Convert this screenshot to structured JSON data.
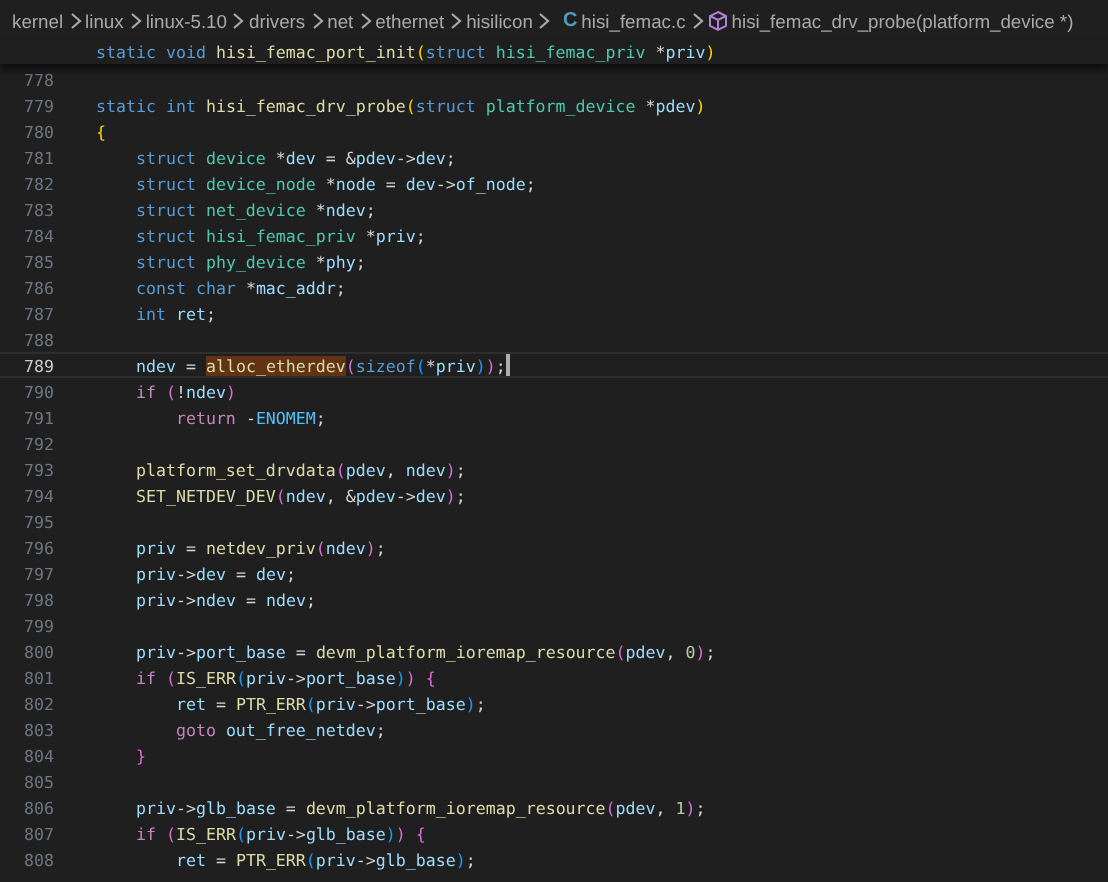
{
  "breadcrumbs": [
    {
      "label": "kernel"
    },
    {
      "label": "linux"
    },
    {
      "label": "linux-5.10"
    },
    {
      "label": "drivers"
    },
    {
      "label": "net"
    },
    {
      "label": "ethernet"
    },
    {
      "label": "hisilicon"
    },
    {
      "label": "hisi_femac.c",
      "kind": "file",
      "icon_text": "C"
    },
    {
      "label": "hisi_femac_drv_probe(platform_device *)",
      "kind": "symbol"
    }
  ],
  "sticky_line": {
    "tokens": [
      {
        "kind": "kw",
        "text": "static void "
      },
      {
        "kind": "fn",
        "text": "hisi_femac_port_init"
      },
      {
        "kind": "b1",
        "text": "("
      },
      {
        "kind": "kw",
        "text": "struct "
      },
      {
        "kind": "type",
        "text": "hisi_femac_priv "
      },
      {
        "kind": "p",
        "text": "*"
      },
      {
        "kind": "var",
        "text": "priv"
      },
      {
        "kind": "b1",
        "text": ")"
      }
    ]
  },
  "lines": [
    {
      "number": "778"
    },
    {
      "number": "779",
      "tokens": [
        {
          "kind": "kw",
          "text": "static int "
        },
        {
          "kind": "fn",
          "text": "hisi_femac_drv_probe"
        },
        {
          "kind": "b1",
          "text": "("
        },
        {
          "kind": "kw",
          "text": "struct "
        },
        {
          "kind": "type",
          "text": "platform_device "
        },
        {
          "kind": "p",
          "text": "*"
        },
        {
          "kind": "var",
          "text": "pdev"
        },
        {
          "kind": "b1",
          "text": ")"
        }
      ]
    },
    {
      "number": "780",
      "tokens": [
        {
          "kind": "b1",
          "text": "{"
        }
      ]
    },
    {
      "number": "781",
      "tokens": [
        {
          "kind": "kw",
          "text": "    struct "
        },
        {
          "kind": "type",
          "text": "device "
        },
        {
          "kind": "p",
          "text": "*"
        },
        {
          "kind": "var",
          "text": "dev"
        },
        {
          "kind": "p",
          "text": " = &"
        },
        {
          "kind": "var",
          "text": "pdev"
        },
        {
          "kind": "p",
          "text": "->"
        },
        {
          "kind": "var",
          "text": "dev"
        },
        {
          "kind": "p",
          "text": ";"
        }
      ]
    },
    {
      "number": "782",
      "tokens": [
        {
          "kind": "kw",
          "text": "    struct "
        },
        {
          "kind": "type",
          "text": "device_node "
        },
        {
          "kind": "p",
          "text": "*"
        },
        {
          "kind": "var",
          "text": "node"
        },
        {
          "kind": "p",
          "text": " = "
        },
        {
          "kind": "var",
          "text": "dev"
        },
        {
          "kind": "p",
          "text": "->"
        },
        {
          "kind": "var",
          "text": "of_node"
        },
        {
          "kind": "p",
          "text": ";"
        }
      ]
    },
    {
      "number": "783",
      "tokens": [
        {
          "kind": "kw",
          "text": "    struct "
        },
        {
          "kind": "type",
          "text": "net_device "
        },
        {
          "kind": "p",
          "text": "*"
        },
        {
          "kind": "var",
          "text": "ndev"
        },
        {
          "kind": "p",
          "text": ";"
        }
      ]
    },
    {
      "number": "784",
      "tokens": [
        {
          "kind": "kw",
          "text": "    struct "
        },
        {
          "kind": "type",
          "text": "hisi_femac_priv "
        },
        {
          "kind": "p",
          "text": "*"
        },
        {
          "kind": "var",
          "text": "priv"
        },
        {
          "kind": "p",
          "text": ";"
        }
      ]
    },
    {
      "number": "785",
      "tokens": [
        {
          "kind": "kw",
          "text": "    struct "
        },
        {
          "kind": "type",
          "text": "phy_device "
        },
        {
          "kind": "p",
          "text": "*"
        },
        {
          "kind": "var",
          "text": "phy"
        },
        {
          "kind": "p",
          "text": ";"
        }
      ]
    },
    {
      "number": "786",
      "tokens": [
        {
          "kind": "kw",
          "text": "    const char "
        },
        {
          "kind": "p",
          "text": "*"
        },
        {
          "kind": "var",
          "text": "mac_addr"
        },
        {
          "kind": "p",
          "text": ";"
        }
      ]
    },
    {
      "number": "787",
      "tokens": [
        {
          "kind": "kw",
          "text": "    int "
        },
        {
          "kind": "var",
          "text": "ret"
        },
        {
          "kind": "p",
          "text": ";"
        }
      ]
    },
    {
      "number": "788"
    },
    {
      "number": "789",
      "current": true,
      "cursor": true,
      "tokens": [
        {
          "kind": "var",
          "text": "    ndev"
        },
        {
          "kind": "p",
          "text": " = "
        },
        {
          "kind": "fn",
          "text": "alloc_etherdev",
          "highlight": true
        },
        {
          "kind": "b2",
          "text": "("
        },
        {
          "kind": "kw",
          "text": "sizeof"
        },
        {
          "kind": "b3",
          "text": "("
        },
        {
          "kind": "p",
          "text": "*"
        },
        {
          "kind": "var",
          "text": "priv"
        },
        {
          "kind": "b3",
          "text": ")"
        },
        {
          "kind": "b2",
          "text": ")"
        },
        {
          "kind": "p",
          "text": ";"
        }
      ]
    },
    {
      "number": "790",
      "tokens": [
        {
          "kind": "ctl",
          "text": "    if "
        },
        {
          "kind": "b2",
          "text": "("
        },
        {
          "kind": "p",
          "text": "!"
        },
        {
          "kind": "var",
          "text": "ndev"
        },
        {
          "kind": "b2",
          "text": ")"
        }
      ]
    },
    {
      "number": "791",
      "tokens": [
        {
          "kind": "ctl",
          "text": "        return "
        },
        {
          "kind": "p",
          "text": "-"
        },
        {
          "kind": "const",
          "text": "ENOMEM"
        },
        {
          "kind": "p",
          "text": ";"
        }
      ]
    },
    {
      "number": "792"
    },
    {
      "number": "793",
      "tokens": [
        {
          "kind": "fn",
          "text": "    platform_set_drvdata"
        },
        {
          "kind": "b2",
          "text": "("
        },
        {
          "kind": "var",
          "text": "pdev"
        },
        {
          "kind": "p",
          "text": ", "
        },
        {
          "kind": "var",
          "text": "ndev"
        },
        {
          "kind": "b2",
          "text": ")"
        },
        {
          "kind": "p",
          "text": ";"
        }
      ]
    },
    {
      "number": "794",
      "tokens": [
        {
          "kind": "fn",
          "text": "    SET_NETDEV_DEV"
        },
        {
          "kind": "b2",
          "text": "("
        },
        {
          "kind": "var",
          "text": "ndev"
        },
        {
          "kind": "p",
          "text": ", &"
        },
        {
          "kind": "var",
          "text": "pdev"
        },
        {
          "kind": "p",
          "text": "->"
        },
        {
          "kind": "var",
          "text": "dev"
        },
        {
          "kind": "b2",
          "text": ")"
        },
        {
          "kind": "p",
          "text": ";"
        }
      ]
    },
    {
      "number": "795"
    },
    {
      "number": "796",
      "tokens": [
        {
          "kind": "var",
          "text": "    priv"
        },
        {
          "kind": "p",
          "text": " = "
        },
        {
          "kind": "fn",
          "text": "netdev_priv"
        },
        {
          "kind": "b2",
          "text": "("
        },
        {
          "kind": "var",
          "text": "ndev"
        },
        {
          "kind": "b2",
          "text": ")"
        },
        {
          "kind": "p",
          "text": ";"
        }
      ]
    },
    {
      "number": "797",
      "tokens": [
        {
          "kind": "var",
          "text": "    priv"
        },
        {
          "kind": "p",
          "text": "->"
        },
        {
          "kind": "var",
          "text": "dev"
        },
        {
          "kind": "p",
          "text": " = "
        },
        {
          "kind": "var",
          "text": "dev"
        },
        {
          "kind": "p",
          "text": ";"
        }
      ]
    },
    {
      "number": "798",
      "tokens": [
        {
          "kind": "var",
          "text": "    priv"
        },
        {
          "kind": "p",
          "text": "->"
        },
        {
          "kind": "var",
          "text": "ndev"
        },
        {
          "kind": "p",
          "text": " = "
        },
        {
          "kind": "var",
          "text": "ndev"
        },
        {
          "kind": "p",
          "text": ";"
        }
      ]
    },
    {
      "number": "799"
    },
    {
      "number": "800",
      "tokens": [
        {
          "kind": "var",
          "text": "    priv"
        },
        {
          "kind": "p",
          "text": "->"
        },
        {
          "kind": "var",
          "text": "port_base"
        },
        {
          "kind": "p",
          "text": " = "
        },
        {
          "kind": "fn",
          "text": "devm_platform_ioremap_resource"
        },
        {
          "kind": "b2",
          "text": "("
        },
        {
          "kind": "var",
          "text": "pdev"
        },
        {
          "kind": "p",
          "text": ", "
        },
        {
          "kind": "num",
          "text": "0"
        },
        {
          "kind": "b2",
          "text": ")"
        },
        {
          "kind": "p",
          "text": ";"
        }
      ]
    },
    {
      "number": "801",
      "tokens": [
        {
          "kind": "ctl",
          "text": "    if "
        },
        {
          "kind": "b2",
          "text": "("
        },
        {
          "kind": "fn",
          "text": "IS_ERR"
        },
        {
          "kind": "b3",
          "text": "("
        },
        {
          "kind": "var",
          "text": "priv"
        },
        {
          "kind": "p",
          "text": "->"
        },
        {
          "kind": "var",
          "text": "port_base"
        },
        {
          "kind": "b3",
          "text": ")"
        },
        {
          "kind": "b2",
          "text": ")"
        },
        {
          "kind": "b2",
          "text": " {"
        }
      ]
    },
    {
      "number": "802",
      "tokens": [
        {
          "kind": "var",
          "text": "        ret"
        },
        {
          "kind": "p",
          "text": " = "
        },
        {
          "kind": "fn",
          "text": "PTR_ERR"
        },
        {
          "kind": "b3",
          "text": "("
        },
        {
          "kind": "var",
          "text": "priv"
        },
        {
          "kind": "p",
          "text": "->"
        },
        {
          "kind": "var",
          "text": "port_base"
        },
        {
          "kind": "b3",
          "text": ")"
        },
        {
          "kind": "p",
          "text": ";"
        }
      ]
    },
    {
      "number": "803",
      "tokens": [
        {
          "kind": "ctl",
          "text": "        goto "
        },
        {
          "kind": "var",
          "text": "out_free_netdev"
        },
        {
          "kind": "p",
          "text": ";"
        }
      ]
    },
    {
      "number": "804",
      "tokens": [
        {
          "kind": "b2",
          "text": "    }"
        }
      ]
    },
    {
      "number": "805"
    },
    {
      "number": "806",
      "tokens": [
        {
          "kind": "var",
          "text": "    priv"
        },
        {
          "kind": "p",
          "text": "->"
        },
        {
          "kind": "var",
          "text": "glb_base"
        },
        {
          "kind": "p",
          "text": " = "
        },
        {
          "kind": "fn",
          "text": "devm_platform_ioremap_resource"
        },
        {
          "kind": "b2",
          "text": "("
        },
        {
          "kind": "var",
          "text": "pdev"
        },
        {
          "kind": "p",
          "text": ", "
        },
        {
          "kind": "num",
          "text": "1"
        },
        {
          "kind": "b2",
          "text": ")"
        },
        {
          "kind": "p",
          "text": ";"
        }
      ]
    },
    {
      "number": "807",
      "tokens": [
        {
          "kind": "ctl",
          "text": "    if "
        },
        {
          "kind": "b2",
          "text": "("
        },
        {
          "kind": "fn",
          "text": "IS_ERR"
        },
        {
          "kind": "b3",
          "text": "("
        },
        {
          "kind": "var",
          "text": "priv"
        },
        {
          "kind": "p",
          "text": "->"
        },
        {
          "kind": "var",
          "text": "glb_base"
        },
        {
          "kind": "b3",
          "text": ")"
        },
        {
          "kind": "b2",
          "text": ")"
        },
        {
          "kind": "b2",
          "text": " {"
        }
      ]
    },
    {
      "number": "808",
      "tokens": [
        {
          "kind": "var",
          "text": "        ret"
        },
        {
          "kind": "p",
          "text": " = "
        },
        {
          "kind": "fn",
          "text": "PTR_ERR"
        },
        {
          "kind": "b3",
          "text": "("
        },
        {
          "kind": "var",
          "text": "priv"
        },
        {
          "kind": "p",
          "text": "->"
        },
        {
          "kind": "var",
          "text": "glb_base"
        },
        {
          "kind": "b3",
          "text": ")"
        },
        {
          "kind": "p",
          "text": ";"
        }
      ]
    }
  ]
}
